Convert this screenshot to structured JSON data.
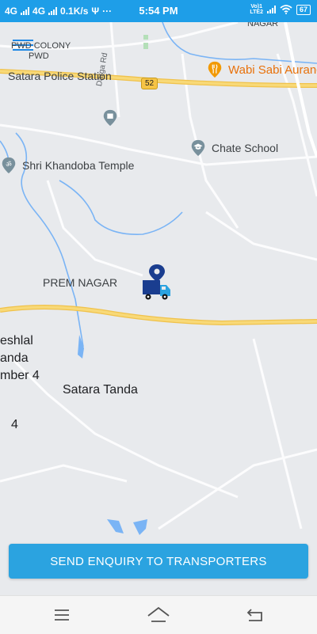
{
  "status_bar": {
    "network1": "4G",
    "network2": "4G",
    "speed": "0.1K/s",
    "usb_symbol": "Ψ",
    "more": "···",
    "time": "5:54 PM",
    "volte_top": "Vo)1",
    "volte_bottom": "LTE2",
    "battery": "67",
    "icons": [
      "signal-icon",
      "signal-icon",
      "usb-icon",
      "wifi-icon",
      "battery-icon"
    ]
  },
  "map": {
    "labels": {
      "nagar_top": "NAGAR",
      "pwd_colony": "PWD COLONY",
      "pwd": "PWD",
      "darga_rd": "Darga Rd",
      "satara_police": "Satara Police Station",
      "route_shield": "52",
      "wabi_sabi": "Wabi Sabi Auranc",
      "chate_school": "Chate School",
      "khandoba": "Shri Khandoba Temple",
      "prem_nagar": "PREM NAGAR",
      "eshlal": "eshlal",
      "anda": "anda",
      "mber4": "mber 4",
      "satara_tanda": "Satara Tanda",
      "four": "4"
    },
    "icons": [
      "menu-icon",
      "restaurant-icon",
      "place-icon",
      "school-icon",
      "temple-icon",
      "truck-location-icon"
    ]
  },
  "actions": {
    "send_enquiry": "SEND ENQUIRY TO TRANSPORTERS"
  },
  "nav": {
    "icons": [
      "recents-icon",
      "home-icon",
      "back-icon"
    ]
  },
  "colors": {
    "status_bar": "#1e9ee8",
    "button": "#2ba3e0",
    "map_bg": "#e8eaed",
    "highway": "#f6d36b",
    "water": "#7ab4f5",
    "truck": "#1a3d8f"
  }
}
